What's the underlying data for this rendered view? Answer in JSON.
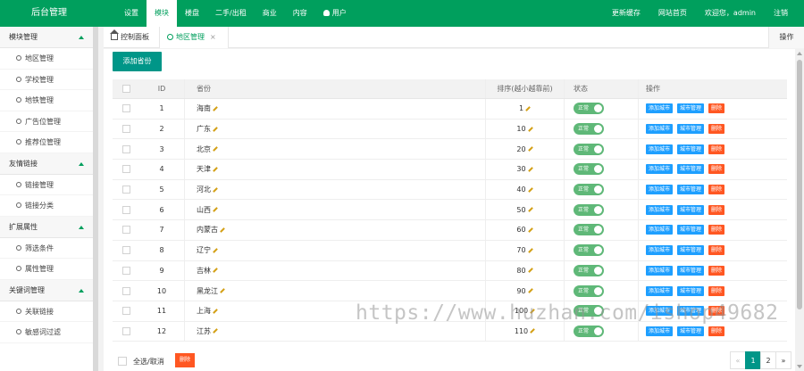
{
  "app": {
    "logo": "后台管理"
  },
  "topnav": [
    "设置",
    "模块",
    "楼盘",
    "二手/出租",
    "商业",
    "内容",
    "用户"
  ],
  "topright": [
    "更新缓存",
    "网站首页",
    "欢迎您，admin",
    "注销"
  ],
  "sidebar": [
    {
      "title": "模块管理",
      "items": [
        "地区管理",
        "学校管理",
        "地铁管理",
        "广告位管理",
        "推荐位管理"
      ]
    },
    {
      "title": "友情链接",
      "items": [
        "链接管理",
        "链接分类"
      ]
    },
    {
      "title": "扩展属性",
      "items": [
        "筛选条件",
        "属性管理"
      ]
    },
    {
      "title": "关键词管理",
      "items": [
        "关联链接",
        "敏感词过滤"
      ]
    }
  ],
  "tabs": {
    "home": "控制面板",
    "current": "地区管理",
    "close": "×",
    "ops": "操作"
  },
  "toolbar": {
    "add_label": "添加省份"
  },
  "table": {
    "headers": {
      "id": "ID",
      "name": "省份",
      "sort": "排序(越小越靠前)",
      "status": "状态",
      "actions": "操作"
    },
    "status_label": "正常",
    "action_labels": {
      "add_city": "添加城市",
      "city_manage": "城市管理",
      "delete": "删除"
    },
    "rows": [
      {
        "id": "1",
        "name": "海南",
        "sort": "1"
      },
      {
        "id": "2",
        "name": "广东",
        "sort": "10"
      },
      {
        "id": "3",
        "name": "北京",
        "sort": "20"
      },
      {
        "id": "4",
        "name": "天津",
        "sort": "30"
      },
      {
        "id": "5",
        "name": "河北",
        "sort": "40"
      },
      {
        "id": "6",
        "name": "山西",
        "sort": "50"
      },
      {
        "id": "7",
        "name": "内蒙古",
        "sort": "60"
      },
      {
        "id": "8",
        "name": "辽宁",
        "sort": "70"
      },
      {
        "id": "9",
        "name": "吉林",
        "sort": "80"
      },
      {
        "id": "10",
        "name": "黑龙江",
        "sort": "90"
      },
      {
        "id": "11",
        "name": "上海",
        "sort": "100"
      },
      {
        "id": "12",
        "name": "江苏",
        "sort": "110"
      }
    ]
  },
  "footer": {
    "select_all": "全选/取消",
    "delete": "删除"
  },
  "pager": {
    "prev": "«",
    "pages": [
      "1",
      "2"
    ],
    "next": "»"
  },
  "watermark": "https://www.huzhan.com/ishop49682",
  "colors": {
    "brand_green": "#009f5d",
    "teal_button": "#009688",
    "blue_button": "#1e9fff",
    "red_button": "#ff5722",
    "switch_on": "#5fb878"
  }
}
